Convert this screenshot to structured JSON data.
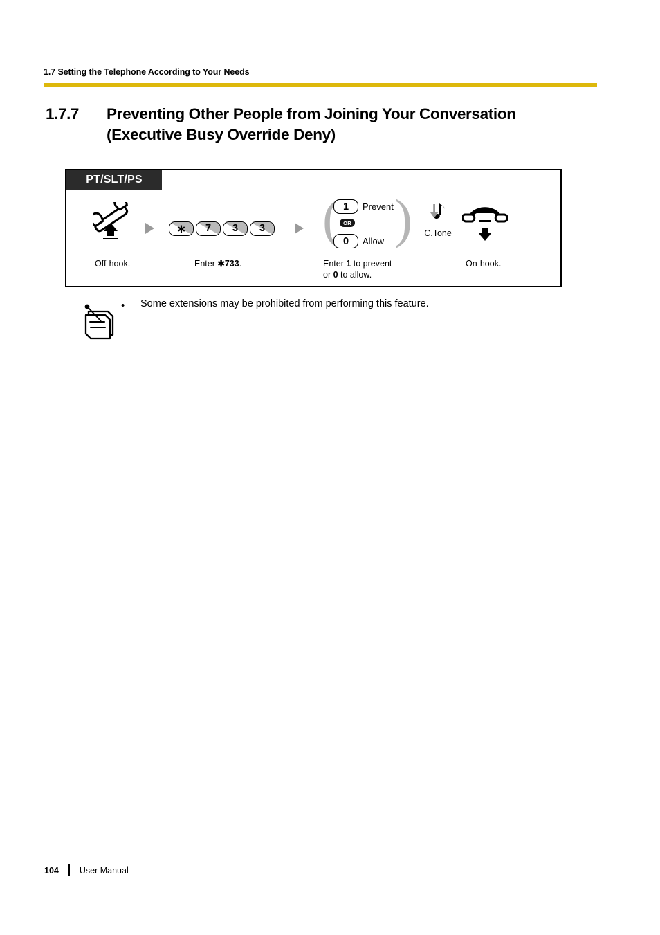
{
  "header": {
    "running_head": "1.7 Setting the Telephone According to Your Needs",
    "rule_color": "#ddb80b"
  },
  "section": {
    "number": "1.7.7",
    "title_line1": "Preventing Other People from Joining Your Conversation",
    "title_line2": "(Executive Busy Override Deny)"
  },
  "procedure": {
    "phone_types": "PT/SLT/PS",
    "steps": {
      "offhook": {
        "icon": "handset-offhook-icon",
        "caption": "Off-hook."
      },
      "enter_code": {
        "keys": [
          "✱",
          "7",
          "3",
          "3"
        ],
        "caption_prefix": "Enter ",
        "caption_code": "✱733",
        "caption_suffix": "."
      },
      "choice": {
        "option_1": {
          "key": "1",
          "label": "Prevent"
        },
        "or_badge": "OR",
        "option_0": {
          "key": "0",
          "label": "Allow"
        },
        "caption_line1_a": "Enter ",
        "caption_line1_b": "1",
        "caption_line1_c": " to prevent",
        "caption_line2_a": "or ",
        "caption_line2_b": "0",
        "caption_line2_c": " to allow."
      },
      "confirmation_tone": {
        "icon": "music-note-icon",
        "label": "C.Tone"
      },
      "onhook": {
        "icon": "handset-onhook-icon",
        "caption": "On-hook."
      }
    }
  },
  "note": {
    "icon": "notepad-pencil-icon",
    "bullet": "•",
    "text": "Some extensions may be prohibited from performing this feature."
  },
  "footer": {
    "page_number": "104",
    "label": "User Manual"
  }
}
